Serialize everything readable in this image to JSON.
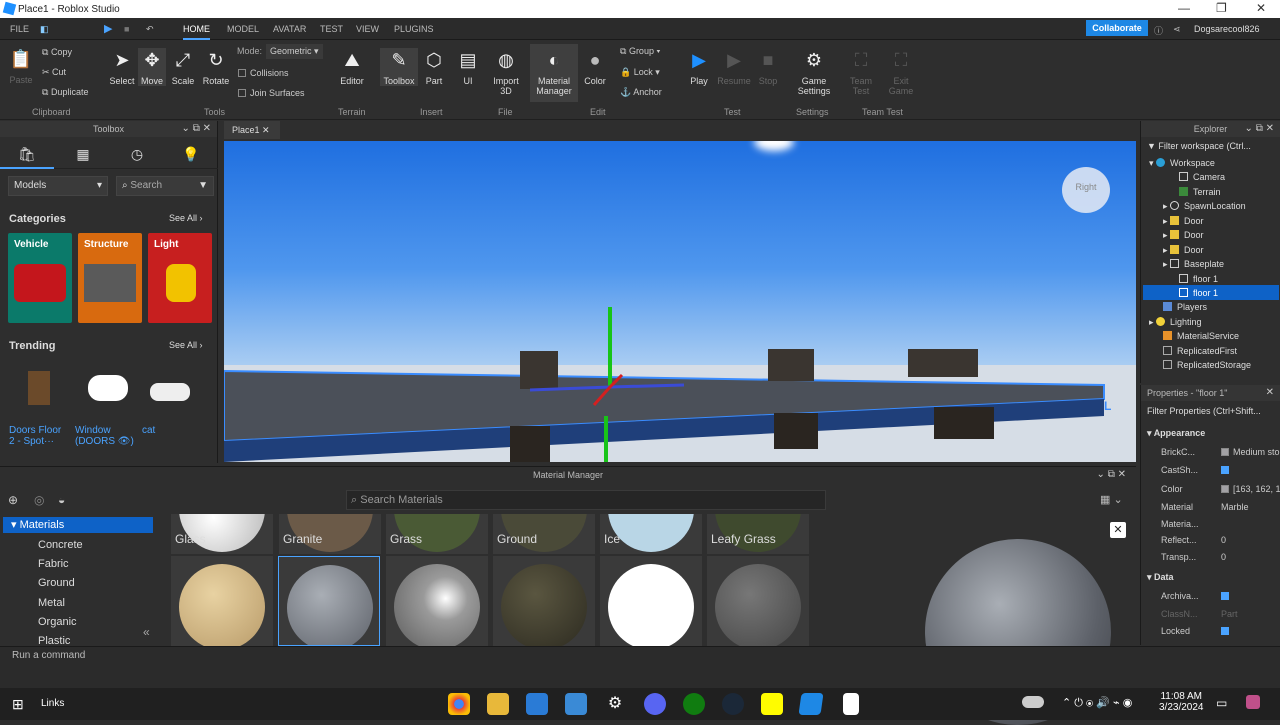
{
  "window": {
    "title": "Place1 - Roblox Studio"
  },
  "menu": {
    "items": [
      "FILE",
      "HOME",
      "MODEL",
      "AVATAR",
      "TEST",
      "VIEW",
      "PLUGINS"
    ],
    "collaborate": "Collaborate",
    "user": "Dogsarecool826"
  },
  "ribbon": {
    "clipboard": {
      "paste": "Paste",
      "copy": "Copy",
      "cut": "Cut",
      "duplicate": "Duplicate",
      "label": "Clipboard"
    },
    "tools": {
      "select": "Select",
      "move": "Move",
      "scale": "Scale",
      "rotate": "Rotate",
      "mode_label": "Mode:",
      "mode_value": "Geometric",
      "collisions": "Collisions",
      "join": "Join Surfaces",
      "label": "Tools"
    },
    "terrain": {
      "editor": "Editor",
      "label": "Terrain"
    },
    "insert": {
      "toolbox": "Toolbox",
      "part": "Part",
      "ui": "UI",
      "label": "Insert"
    },
    "file": {
      "import": "Import",
      "import2": "3D",
      "label": "File"
    },
    "edit": {
      "matmgr": "Material",
      "matmgr2": "Manager",
      "color": "Color",
      "group": "Group",
      "lock": "Lock",
      "anchor": "Anchor",
      "label": "Edit"
    },
    "test": {
      "play": "Play",
      "resume": "Resume",
      "stop": "Stop",
      "label": "Test"
    },
    "settings": {
      "game": "Game",
      "game2": "Settings",
      "label": "Settings"
    },
    "teamtest": {
      "team": "Team",
      "team2": "Test",
      "exit": "Exit",
      "exit2": "Game",
      "label": "Team Test"
    }
  },
  "toolbox": {
    "title": "Toolbox",
    "dropdown": "Models",
    "search": "Search",
    "categories": "Categories",
    "see_all": "See All ›",
    "cat": [
      "Vehicle",
      "Structure",
      "Light"
    ],
    "trending": "Trending",
    "trend": [
      {
        "l1": "Doors Floor",
        "l2": "2 - Spot···"
      },
      {
        "l1": "Window",
        "l2": "(DOORS 👁)"
      },
      {
        "l1": "cat",
        "l2": ""
      }
    ]
  },
  "viewport": {
    "tab": "Place1",
    "gizmo": "Right"
  },
  "explorer": {
    "title": "Explorer",
    "filter": "Filter workspace (Ctrl...",
    "items": [
      "Workspace",
      "Camera",
      "Terrain",
      "SpawnLocation",
      "Door",
      "Door",
      "Door",
      "Baseplate",
      "floor 1",
      "floor 1",
      "Players",
      "Lighting",
      "MaterialService",
      "ReplicatedFirst",
      "ReplicatedStorage"
    ]
  },
  "properties": {
    "title": "Properties - \"floor 1\"",
    "filter": "Filter Properties (Ctrl+Shift...",
    "appearance": "Appearance",
    "rows": [
      {
        "k": "BrickC...",
        "v": "Medium sto"
      },
      {
        "k": "CastSh...",
        "v": ""
      },
      {
        "k": "Color",
        "v": "[163, 162, 1"
      },
      {
        "k": "Material",
        "v": "Marble"
      },
      {
        "k": "Materia...",
        "v": ""
      },
      {
        "k": "Reflect...",
        "v": "0"
      },
      {
        "k": "Transp...",
        "v": "0"
      }
    ],
    "data": "Data",
    "rows2": [
      {
        "k": "Archiva...",
        "v": ""
      },
      {
        "k": "ClassN...",
        "v": "Part"
      },
      {
        "k": "Locked",
        "v": ""
      }
    ]
  },
  "material_manager": {
    "title": "Material Manager",
    "search": "Search Materials",
    "root": "Materials",
    "list": [
      "Concrete",
      "Fabric",
      "Ground",
      "Metal",
      "Organic",
      "Plastic"
    ],
    "top": [
      "Glass",
      "Granite",
      "Grass",
      "Ground",
      "Ice",
      "Leafy Grass"
    ]
  },
  "command": {
    "placeholder": "Run a command"
  },
  "taskbar": {
    "links": "Links",
    "time": "11:08 AM",
    "date": "3/23/2024"
  }
}
